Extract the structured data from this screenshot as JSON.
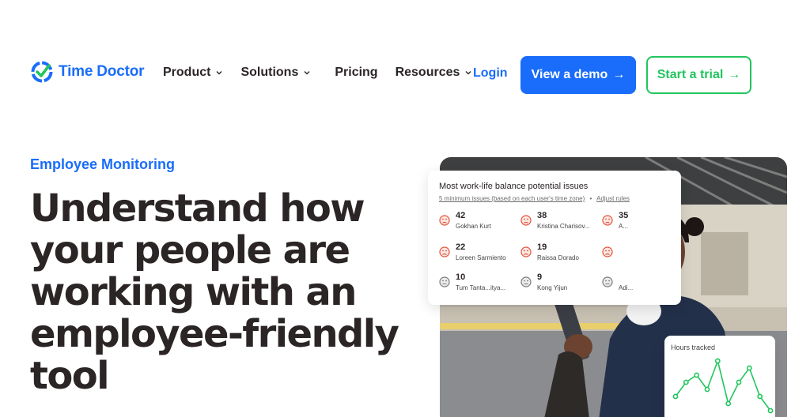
{
  "header": {
    "logo_text": "Time Doctor",
    "nav": [
      {
        "label": "Product",
        "has_dropdown": true
      },
      {
        "label": "Solutions",
        "has_dropdown": true
      },
      {
        "label": "Pricing",
        "has_dropdown": false
      },
      {
        "label": "Resources",
        "has_dropdown": true
      }
    ],
    "login_label": "Login",
    "demo_label": "View a demo",
    "trial_label": "Start a trial",
    "arrow": "→",
    "colors": {
      "brand_blue": "#1a6dfa",
      "trial_green": "#22c55e",
      "text_dark": "#2b2525"
    }
  },
  "hero": {
    "eyebrow": "Employee Monitoring",
    "headline": "Understand how your people are working with an employee-friendly tool"
  },
  "issues_card": {
    "title": "Most work-life balance potential issues",
    "subtitle_link": "5 minimum issues (based on each user's time zone)",
    "subtitle_sep": "•",
    "adjust_link": "Adjust rules",
    "items": [
      {
        "count": "42",
        "name": "Gokhan Kurt",
        "mood": "sad-red"
      },
      {
        "count": "38",
        "name": "Kristina Charisov...",
        "mood": "sad-red"
      },
      {
        "count": "35",
        "name": "A...",
        "mood": "sad-red"
      },
      {
        "count": "22",
        "name": "Loreen Sarmiento",
        "mood": "sad-red"
      },
      {
        "count": "19",
        "name": "Raissa Dorado",
        "mood": "sad-red"
      },
      {
        "count": "",
        "name": "",
        "mood": "sad-red"
      },
      {
        "count": "10",
        "name": "Tum Tanta...itya...",
        "mood": "neutral-gray"
      },
      {
        "count": "9",
        "name": "Kong Yijun",
        "mood": "neutral-gray"
      },
      {
        "count": "",
        "name": "Adi...",
        "mood": "neutral-gray"
      }
    ]
  },
  "hours_card": {
    "title": "Hours tracked",
    "series": [
      3,
      5,
      6,
      4,
      8,
      2,
      5,
      7,
      3,
      1
    ]
  }
}
